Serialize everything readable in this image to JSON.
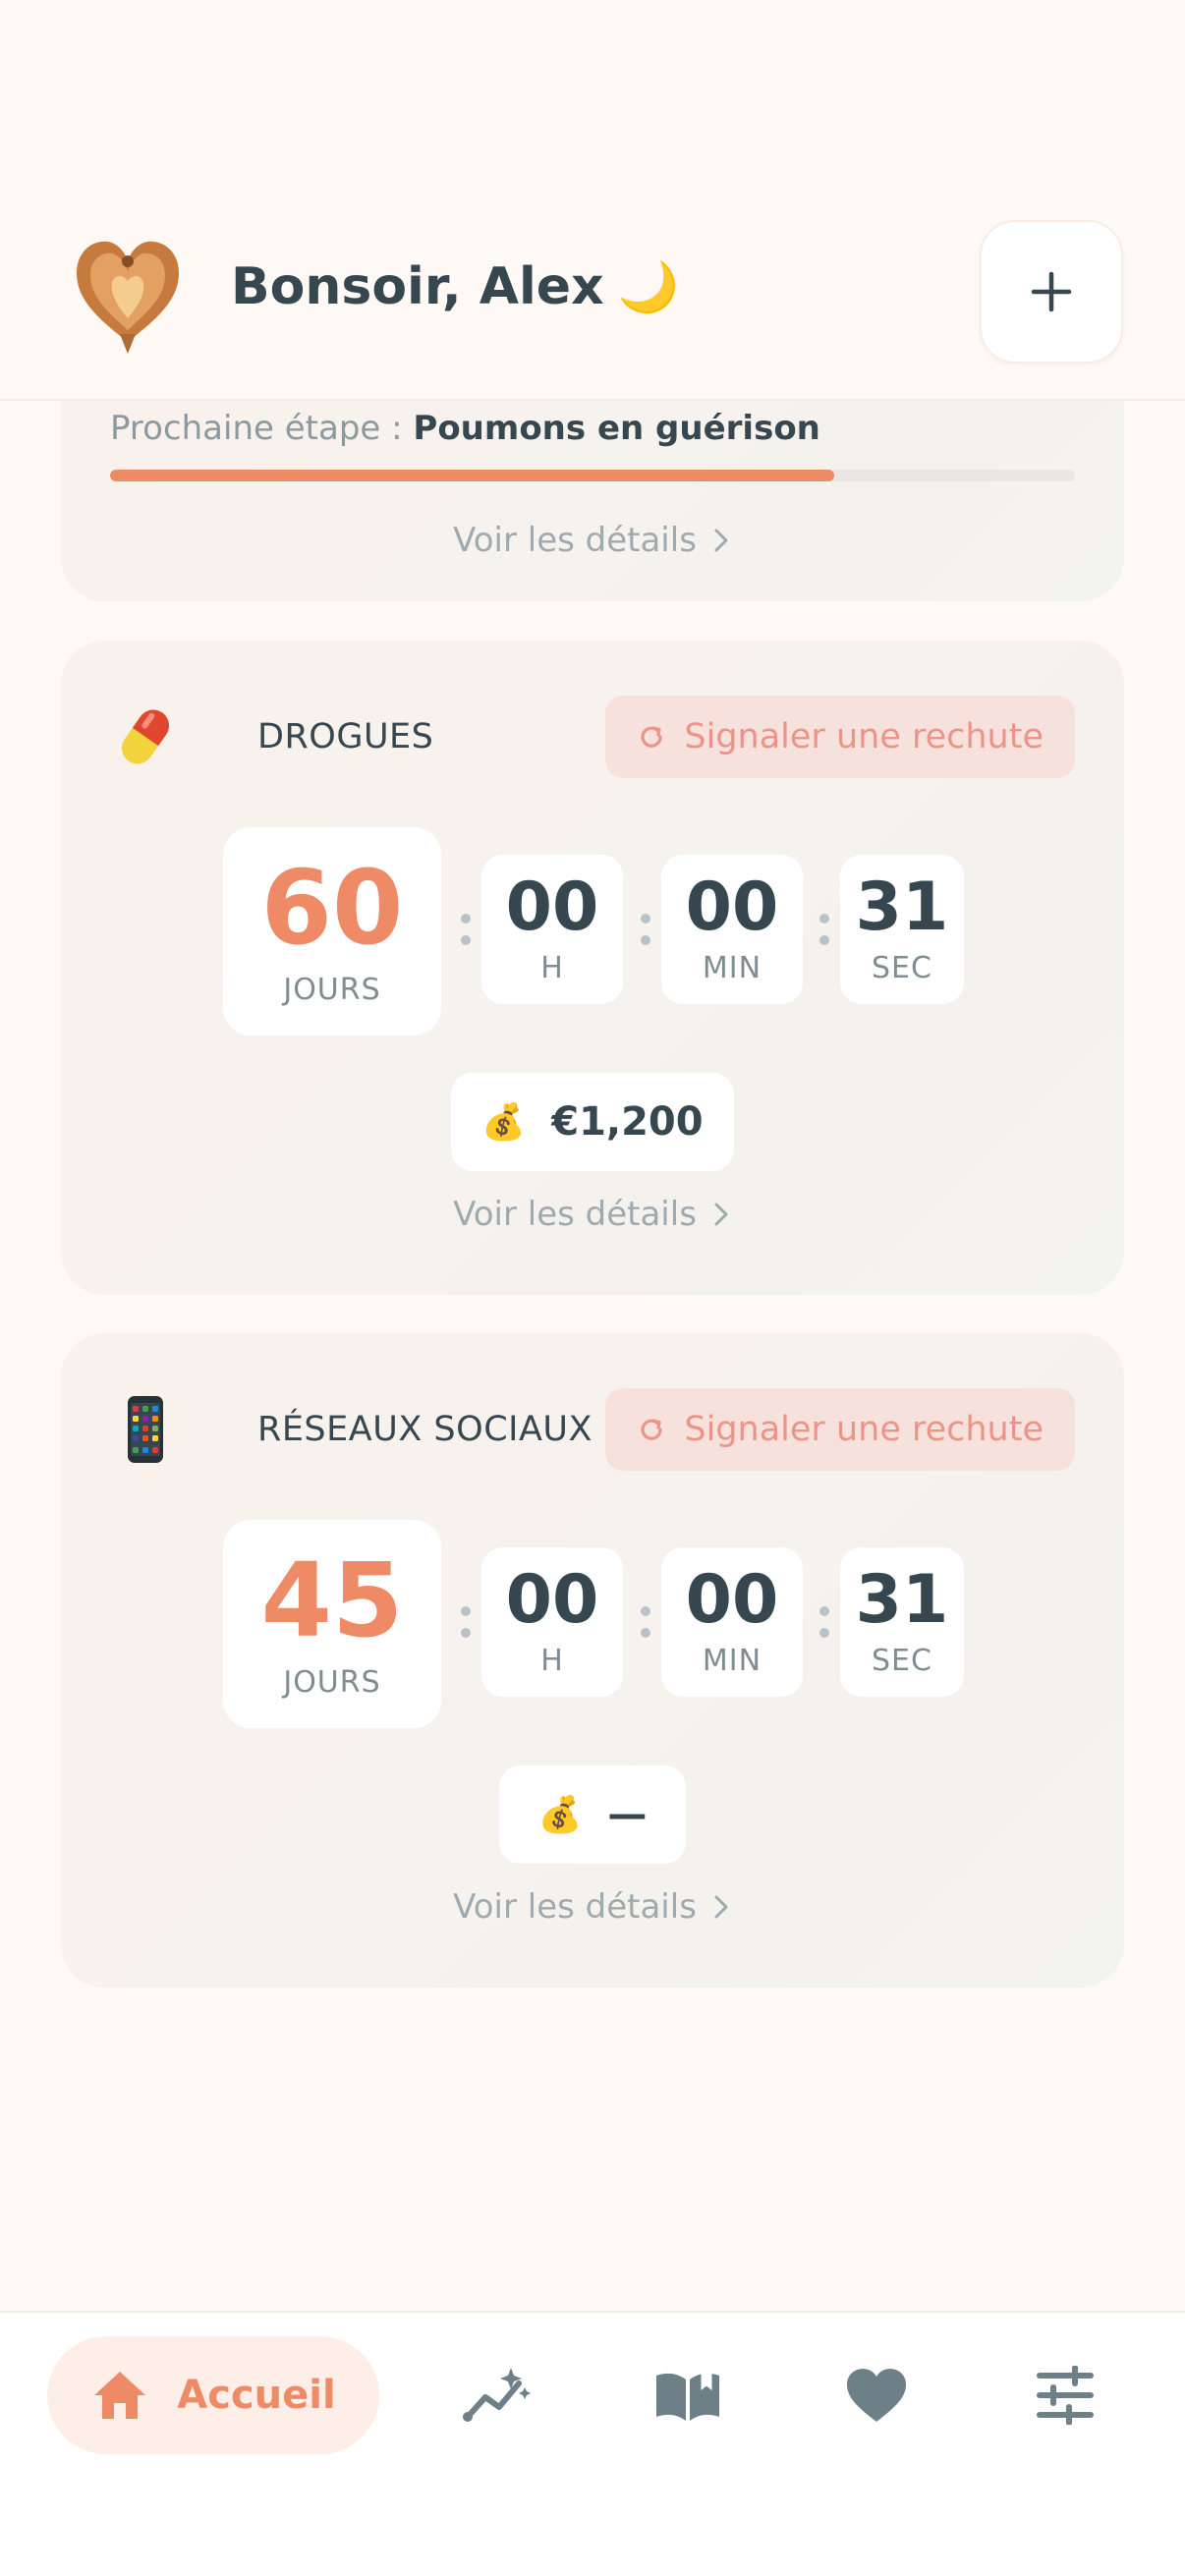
{
  "header": {
    "greeting": "Bonsoir, Alex",
    "greeting_emoji": "🌙"
  },
  "milestone": {
    "label": "Prochaine étape :",
    "value": "Poumons en guérison",
    "progress": 0.75,
    "details_link": "Voir les détails"
  },
  "addictions": [
    {
      "title": "DROGUES",
      "icon": "pill-icon",
      "relapse_label": "Signaler une rechute",
      "days": "60",
      "days_unit": "JOURS",
      "hours": "00",
      "hours_unit": "H",
      "minutes": "00",
      "minutes_unit": "MIN",
      "seconds": "31",
      "seconds_unit": "SEC",
      "money_icon": "💰",
      "money": "€1,200",
      "details_link": "Voir les détails"
    },
    {
      "title": "RÉSEAUX SOCIAUX",
      "icon": "phone-icon",
      "relapse_label": "Signaler une rechute",
      "days": "45",
      "days_unit": "JOURS",
      "hours": "00",
      "hours_unit": "H",
      "minutes": "00",
      "minutes_unit": "MIN",
      "seconds": "31",
      "seconds_unit": "SEC",
      "money_icon": "💰",
      "money": "—",
      "details_link": "Voir les détails"
    }
  ],
  "nav": {
    "home_label": "Accueil",
    "items": [
      "home-icon",
      "stats-icon",
      "journal-icon",
      "health-icon",
      "settings-icon"
    ]
  },
  "colors": {
    "accent": "#EE8B66",
    "text": "#37474F",
    "muted": "#9FAAAF",
    "relapse_bg": "#F6E1DC",
    "relapse_text": "#EC9487"
  }
}
